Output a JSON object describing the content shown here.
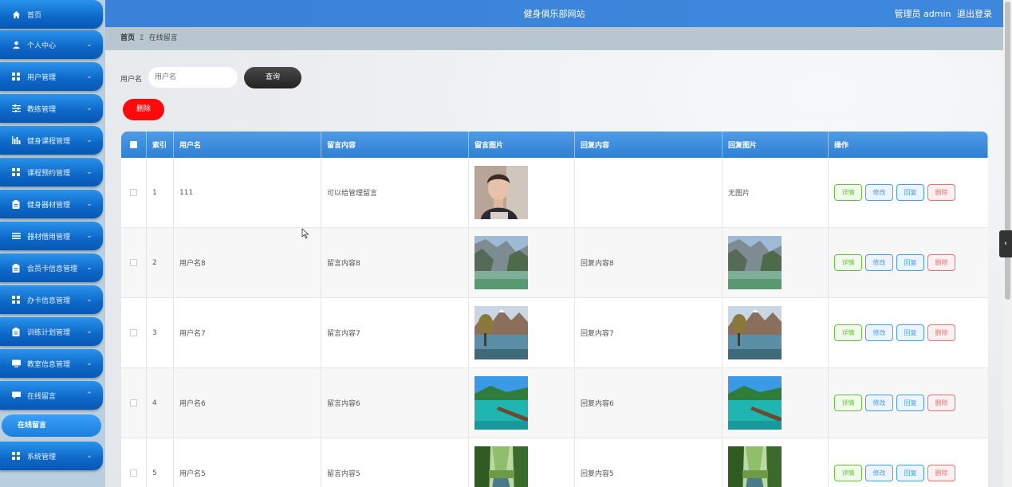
{
  "sidebar": {
    "items": [
      {
        "label": "首页",
        "icon": "home-icon",
        "chevron": ""
      },
      {
        "label": "个人中心",
        "icon": "user-icon",
        "chevron": "⌄"
      },
      {
        "label": "用户管理",
        "icon": "grid-icon",
        "chevron": "⌄"
      },
      {
        "label": "教练管理",
        "icon": "sliders-icon",
        "chevron": "⌄"
      },
      {
        "label": "健身课程管理",
        "icon": "chart-icon",
        "chevron": "⌄"
      },
      {
        "label": "课程预约管理",
        "icon": "grid-icon",
        "chevron": "⌄"
      },
      {
        "label": "健身器材管理",
        "icon": "clipboard-icon",
        "chevron": "⌄"
      },
      {
        "label": "器材借用管理",
        "icon": "list-icon",
        "chevron": "⌄"
      },
      {
        "label": "会员卡信息管理",
        "icon": "clipboard-icon",
        "chevron": "⌄"
      },
      {
        "label": "办卡信息管理",
        "icon": "grid-icon",
        "chevron": "⌄"
      },
      {
        "label": "训练计划管理",
        "icon": "clipboard-icon",
        "chevron": "⌄"
      },
      {
        "label": "教室信息管理",
        "icon": "monitor-icon",
        "chevron": "⌄"
      },
      {
        "label": "在线留言",
        "icon": "chat-icon",
        "chevron": "⌃"
      },
      {
        "label": "系统管理",
        "icon": "grid-icon",
        "chevron": "⌄"
      }
    ],
    "sub_item": "在线留言"
  },
  "header": {
    "title": "健身俱乐部网站",
    "user_label": "管理员 admin",
    "logout": "退出登录"
  },
  "breadcrumb": {
    "home": "首页",
    "separator": "Σ",
    "current": "在线留言"
  },
  "search": {
    "label": "用户名",
    "placeholder": "用户名",
    "query_button": "查询"
  },
  "toolbar": {
    "delete_label": "删除"
  },
  "table": {
    "headers": [
      "索引",
      "用户名",
      "留言内容",
      "留言图片",
      "回复内容",
      "回复图片",
      "操作"
    ],
    "rows": [
      {
        "index": "1",
        "username": "111",
        "content": "可以给管理留言",
        "image": "portrait",
        "reply": "",
        "reply_image": "",
        "reply_image_text": "无图片"
      },
      {
        "index": "2",
        "username": "用户名8",
        "content": "留言内容8",
        "image": "cliff-lake",
        "reply": "回复内容8",
        "reply_image": "cliff-lake",
        "reply_image_text": ""
      },
      {
        "index": "3",
        "username": "用户名7",
        "content": "留言内容7",
        "image": "mountain-lake",
        "reply": "回复内容7",
        "reply_image": "mountain-lake",
        "reply_image_text": ""
      },
      {
        "index": "4",
        "username": "用户名6",
        "content": "留言内容6",
        "image": "tropical-pier",
        "reply": "回复内容6",
        "reply_image": "tropical-pier",
        "reply_image_text": ""
      },
      {
        "index": "5",
        "username": "用户名5",
        "content": "留言内容5",
        "image": "forest-river",
        "reply": "回复内容5",
        "reply_image": "forest-river",
        "reply_image_text": ""
      }
    ],
    "actions": {
      "detail": "详情",
      "edit": "修改",
      "reply": "回复",
      "delete": "删除"
    }
  },
  "side_tab": {
    "icon": "chevron-left-icon",
    "glyph": "‹"
  }
}
